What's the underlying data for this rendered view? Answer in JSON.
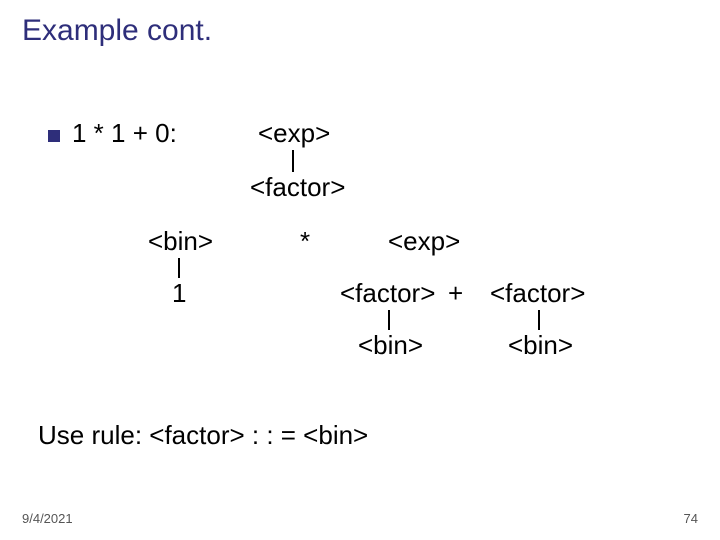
{
  "title": "Example cont.",
  "bullet": {
    "expr": "1 * 1 + 0:"
  },
  "tree": {
    "n_exp_top": "<exp>",
    "n_factor_top": "<factor>",
    "n_bin_l": "<bin>",
    "n_star": "*",
    "n_exp_r": "<exp>",
    "n_one": "1",
    "n_factor_m": "<factor>",
    "n_plus": "+",
    "n_factor_r": "<factor>",
    "n_bin_m": "<bin>",
    "n_bin_r": "<bin>"
  },
  "rule": "Use rule:  <factor> : : = <bin>",
  "footer": {
    "date": "9/4/2021",
    "page": "74"
  }
}
